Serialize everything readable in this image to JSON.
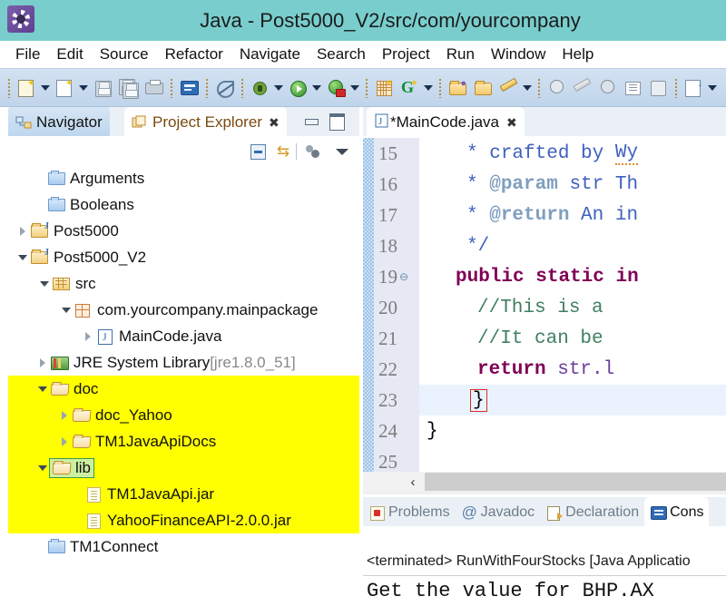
{
  "window": {
    "icon": "eclipse-gear-icon",
    "title": "Java - Post5000_V2/src/com/yourcompany",
    "accent_color": "#79cdcd"
  },
  "menubar": {
    "items": [
      "File",
      "Edit",
      "Source",
      "Refactor",
      "Navigate",
      "Search",
      "Project",
      "Run",
      "Window",
      "Help"
    ]
  },
  "toolbar": {
    "groups": [
      {
        "items": [
          {
            "name": "new-wizard-icon",
            "dropdown": true
          },
          {
            "name": "new-java-class-icon",
            "dropdown": true
          }
        ]
      },
      {
        "items": [
          {
            "name": "save-icon",
            "dropdown": false
          },
          {
            "name": "save-all-icon",
            "dropdown": false
          },
          {
            "name": "print-icon",
            "dropdown": false
          }
        ]
      },
      {
        "items": [
          {
            "name": "open-console-icon",
            "dropdown": false
          }
        ]
      },
      {
        "items": [
          {
            "name": "toggle-mark-occurrences-icon",
            "dropdown": false
          }
        ]
      },
      {
        "items": [
          {
            "name": "debug-icon",
            "dropdown": true
          },
          {
            "name": "run-icon",
            "dropdown": true
          },
          {
            "name": "run-external-tools-icon",
            "dropdown": true
          }
        ]
      },
      {
        "items": [
          {
            "name": "new-java-package-icon",
            "dropdown": false
          },
          {
            "name": "new-annotation-icon",
            "dropdown": true
          }
        ]
      },
      {
        "items": [
          {
            "name": "open-type-icon",
            "dropdown": false
          },
          {
            "name": "open-task-icon",
            "dropdown": false
          },
          {
            "name": "search-declaration-icon",
            "dropdown": true
          }
        ]
      },
      {
        "items": [
          {
            "name": "next-annotation-icon",
            "dropdown": false
          },
          {
            "name": "previous-annotation-icon",
            "dropdown": false
          },
          {
            "name": "last-edit-location-icon",
            "dropdown": false
          },
          {
            "name": "back-icon",
            "dropdown": false
          },
          {
            "name": "forward-icon",
            "dropdown": false
          }
        ]
      },
      {
        "items": [
          {
            "name": "pin-editor-icon",
            "dropdown": true
          }
        ]
      }
    ]
  },
  "left_view": {
    "tabs": [
      {
        "label": "Navigator",
        "icon": "navigator-icon",
        "active": false,
        "closable": false
      },
      {
        "label": "Project Explorer",
        "icon": "project-explorer-icon",
        "active": true,
        "closable": true,
        "close_glyph": "✖"
      }
    ],
    "view_buttons": [
      {
        "name": "minimize-view-button"
      },
      {
        "name": "maximize-view-button"
      }
    ],
    "toolbar": [
      {
        "name": "collapse-all-icon"
      },
      {
        "name": "link-with-editor-icon"
      },
      {
        "name": "focus-on-active-task-icon"
      },
      {
        "name": "view-menu-icon"
      }
    ],
    "tree": [
      {
        "label": "Arguments",
        "indent": 1,
        "arrow": "none",
        "icon": "blue-folder-icon",
        "highlight": false,
        "selected": false
      },
      {
        "label": "Booleans",
        "indent": 1,
        "arrow": "none",
        "icon": "blue-folder-icon",
        "highlight": false,
        "selected": false
      },
      {
        "label": "Post5000",
        "indent": 0,
        "arrow": "closed",
        "icon": "java-project-icon",
        "highlight": false,
        "selected": false
      },
      {
        "label": "Post5000_V2",
        "indent": 0,
        "arrow": "open",
        "icon": "java-project-icon",
        "highlight": false,
        "selected": false
      },
      {
        "label": "src",
        "indent": 1,
        "arrow": "open",
        "icon": "source-folder-icon",
        "highlight": false,
        "selected": false
      },
      {
        "label": "com.yourcompany.mainpackage",
        "indent": 2,
        "arrow": "open",
        "icon": "package-icon",
        "highlight": false,
        "selected": false
      },
      {
        "label": "MainCode.java",
        "indent": 3,
        "arrow": "closed",
        "icon": "java-file-icon",
        "highlight": false,
        "selected": false
      },
      {
        "label": "JRE System Library",
        "suffix": " [jre1.8.0_51]",
        "indent": 1,
        "arrow": "closed",
        "icon": "jre-library-icon",
        "highlight": false,
        "selected": false
      },
      {
        "label": "doc",
        "indent": 1,
        "arrow": "open",
        "icon": "open-folder-icon",
        "highlight": true,
        "selected": false
      },
      {
        "label": "doc_Yahoo",
        "indent": 2,
        "arrow": "closed",
        "icon": "open-folder-icon",
        "highlight": true,
        "selected": false
      },
      {
        "label": "TM1JavaApiDocs",
        "indent": 2,
        "arrow": "closed",
        "icon": "open-folder-icon",
        "highlight": true,
        "selected": false
      },
      {
        "label": "lib",
        "indent": 1,
        "arrow": "open",
        "icon": "open-folder-icon",
        "highlight": true,
        "selected": true
      },
      {
        "label": "TM1JavaApi.jar",
        "indent": 2,
        "arrow": "none",
        "icon": "jar-file-icon",
        "highlight": true,
        "selected": false
      },
      {
        "label": "YahooFinanceAPI-2.0.0.jar",
        "indent": 2,
        "arrow": "none",
        "icon": "jar-file-icon",
        "highlight": true,
        "selected": false
      },
      {
        "label": "TM1Connect",
        "indent": 0,
        "arrow": "none",
        "icon": "blue-folder-icon",
        "highlight": false,
        "selected": false
      }
    ],
    "highlight_color": "#ffff00",
    "selection_color": "#ccf0a0"
  },
  "editor": {
    "tab": {
      "label": "*MainCode.java",
      "icon": "java-file-icon",
      "close_glyph": "✖"
    },
    "lines": [
      {
        "number": "15",
        "folding": false,
        "highlight": false,
        "text": "     * crafted by Wy"
      },
      {
        "number": "16",
        "folding": false,
        "highlight": false,
        "text": "     * @param str Th"
      },
      {
        "number": "17",
        "folding": false,
        "highlight": false,
        "text": "     * @return An in"
      },
      {
        "number": "18",
        "folding": false,
        "highlight": false,
        "text": "     */"
      },
      {
        "number": "19",
        "folding": true,
        "highlight": false,
        "text": "    public static in"
      },
      {
        "number": "20",
        "folding": false,
        "highlight": false,
        "text": "        //This is a "
      },
      {
        "number": "21",
        "folding": false,
        "highlight": false,
        "text": "        //It can be "
      },
      {
        "number": "22",
        "folding": false,
        "highlight": false,
        "text": "        return str.l"
      },
      {
        "number": "23",
        "folding": false,
        "highlight": true,
        "text": "    }"
      },
      {
        "number": "24",
        "folding": false,
        "highlight": false,
        "text": "}"
      },
      {
        "number": "25",
        "folding": false,
        "highlight": false,
        "text": ""
      }
    ],
    "code_tokens": {
      "l15_star": "*",
      "l15_text": "crafted by ",
      "l15_spell": "Wy",
      "l16_star": "*",
      "l16_tag": "@param",
      "l16_text": " str Th",
      "l17_star": "*",
      "l17_tag": "@return",
      "l17_text": " An in",
      "l18_text": "*/",
      "l19_kw1": "public",
      "l19_kw2": "static",
      "l19_kw3": "in",
      "l20_comment": "//This is a ",
      "l21_comment": "//It can be ",
      "l22_kw": "return",
      "l22_expr": " str.l",
      "l23_brace": "}",
      "l24_brace": "}"
    },
    "fold_glyph": "⊖",
    "hscroll_left_glyph": "‹"
  },
  "bottom_view": {
    "tabs": [
      {
        "label": "Problems",
        "icon": "problems-icon",
        "active": false
      },
      {
        "label": "Javadoc",
        "icon": "javadoc-icon",
        "active": false
      },
      {
        "label": "Declaration",
        "icon": "declaration-icon",
        "active": false
      },
      {
        "label": "Cons",
        "icon": "console-icon",
        "active": true
      }
    ],
    "console": {
      "launch_line": "<terminated> RunWithFourStocks [Java Applicatio",
      "output": "Get the value for BHP.AX"
    }
  }
}
